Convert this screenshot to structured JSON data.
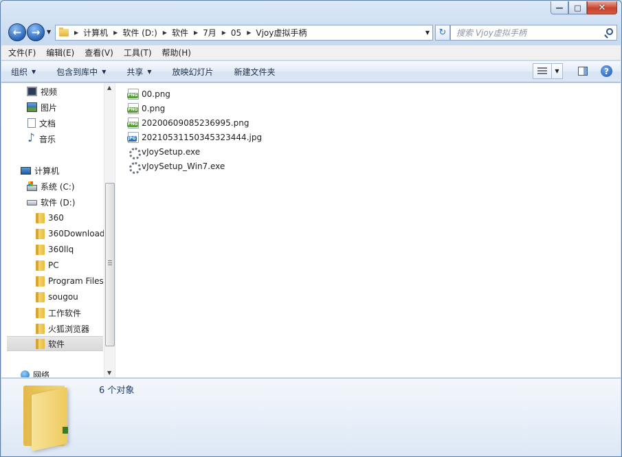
{
  "window": {
    "minimize_glyph": "—",
    "maximize_glyph": "□",
    "close_glyph": "✕"
  },
  "nav": {
    "back_icon": "back-arrow-icon",
    "forward_icon": "forward-arrow-icon",
    "breadcrumbs": [
      "计算机",
      "软件 (D:)",
      "软件",
      "7月",
      "05",
      "Vjoy虚拟手柄"
    ],
    "search_placeholder": "搜索 Vjoy虚拟手柄"
  },
  "menu": [
    "文件(F)",
    "编辑(E)",
    "查看(V)",
    "工具(T)",
    "帮助(H)"
  ],
  "toolbar": {
    "organize": "组织",
    "include_library": "包含到库中",
    "share": "共享",
    "slideshow": "放映幻灯片",
    "new_folder": "新建文件夹"
  },
  "sidebar": {
    "items": [
      {
        "label": "视频",
        "icon": "video-library-icon"
      },
      {
        "label": "图片",
        "icon": "pictures-library-icon"
      },
      {
        "label": "文档",
        "icon": "documents-library-icon"
      },
      {
        "label": "音乐",
        "icon": "music-library-icon"
      },
      {
        "label": "计算机",
        "icon": "computer-icon"
      },
      {
        "label": "系统 (C:)",
        "icon": "system-drive-icon"
      },
      {
        "label": "软件 (D:)",
        "icon": "drive-icon"
      },
      {
        "label": "360",
        "icon": "folder-icon"
      },
      {
        "label": "360Download",
        "icon": "folder-icon"
      },
      {
        "label": "360llq",
        "icon": "folder-icon"
      },
      {
        "label": "PC",
        "icon": "folder-icon"
      },
      {
        "label": "Program Files",
        "icon": "folder-icon"
      },
      {
        "label": "sougou",
        "icon": "folder-icon"
      },
      {
        "label": "工作软件",
        "icon": "folder-icon"
      },
      {
        "label": "火狐浏览器",
        "icon": "folder-icon"
      },
      {
        "label": "软件",
        "icon": "folder-icon",
        "selected": true
      },
      {
        "label": "网络",
        "icon": "network-icon"
      }
    ]
  },
  "files": [
    {
      "name": "00.png",
      "type": "png",
      "icon": "png-file-icon",
      "tag": "PNG"
    },
    {
      "name": "0.png",
      "type": "png",
      "icon": "png-file-icon",
      "tag": "PNG"
    },
    {
      "name": "20200609085236995.png",
      "type": "png",
      "icon": "png-file-icon",
      "tag": "PNG"
    },
    {
      "name": "20210531150345323444.jpg",
      "type": "jpg",
      "icon": "jpg-file-icon",
      "tag": "JPG"
    },
    {
      "name": "vJoySetup.exe",
      "type": "exe",
      "icon": "exe-file-icon"
    },
    {
      "name": "vJoySetup_Win7.exe",
      "type": "exe",
      "icon": "exe-file-icon"
    }
  ],
  "details": {
    "object_count": "6 个对象"
  },
  "colors": {
    "accent": "#2a6fc4",
    "selection": "#d9d9d9"
  }
}
